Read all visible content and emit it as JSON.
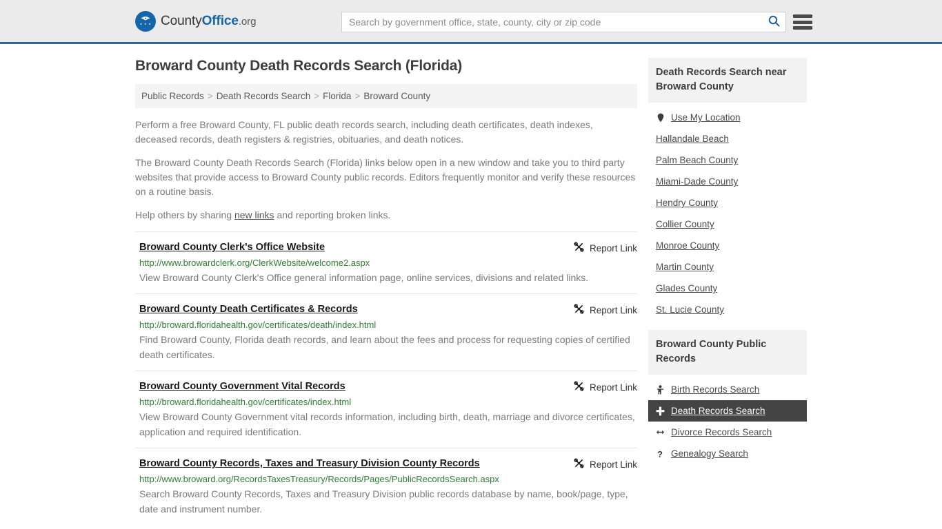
{
  "header": {
    "logo_name_1": "County",
    "logo_name_2": "Office",
    "logo_name_3": ".org",
    "search_placeholder": "Search by government office, state, county, city or zip code",
    "search_value": "",
    "search_icon": "search-icon",
    "menu_icon": "hamburger-menu-icon"
  },
  "main": {
    "title": "Broward County Death Records Search (Florida)",
    "breadcrumb": [
      "Public Records",
      "Death Records Search",
      "Florida",
      "Broward County"
    ],
    "breadcrumb_separator": ">",
    "intro": {
      "p1": "Perform a free Broward County, FL public death records search, including death certificates, death indexes, deceased records, death registers & registries, obituaries, and death notices.",
      "p2": "The Broward County Death Records Search (Florida) links below open in a new window and take you to third party websites that provide access to Broward County public records. Editors frequently monitor and verify these resources on a routine basis.",
      "p3_before": "Help others by sharing ",
      "p3_link": "new links",
      "p3_after": " and reporting broken links."
    },
    "report_label": "Report Link",
    "report_icon": "broken-link-icon",
    "results": [
      {
        "title": "Broward County Clerk's Office Website",
        "url": "http://www.browardclerk.org/ClerkWebsite/welcome2.aspx",
        "desc": "View Broward County Clerk's Office general information page, online services, divisions and related links."
      },
      {
        "title": "Broward County Death Certificates & Records",
        "url": "http://broward.floridahealth.gov/certificates/death/index.html",
        "desc": "Find Broward County, Florida death records, and learn about the fees and process for requesting copies of certified death certificates."
      },
      {
        "title": "Broward County Government Vital Records",
        "url": "http://broward.floridahealth.gov/certificates/index.html",
        "desc": "View Broward County Government vital records information, including birth, death, marriage and divorce certificates, application and required identification."
      },
      {
        "title": "Broward County Records, Taxes and Treasury Division County Records",
        "url": "http://www.broward.org/RecordsTaxesTreasury/Records/Pages/PublicRecordsSearch.aspx",
        "desc": "Search Broward County Records, Taxes and Treasury Division public records database by name, book/page, type, date and instrument number."
      }
    ]
  },
  "sidebar": {
    "nearby": {
      "heading": "Death Records Search near Broward County",
      "items": [
        {
          "label": "Use My Location",
          "icon": "map-pin-icon"
        },
        {
          "label": "Hallandale Beach",
          "icon": ""
        },
        {
          "label": "Palm Beach County",
          "icon": ""
        },
        {
          "label": "Miami-Dade County",
          "icon": ""
        },
        {
          "label": "Hendry County",
          "icon": ""
        },
        {
          "label": "Collier County",
          "icon": ""
        },
        {
          "label": "Monroe County",
          "icon": ""
        },
        {
          "label": "Martin County",
          "icon": ""
        },
        {
          "label": "Glades County",
          "icon": ""
        },
        {
          "label": "St. Lucie County",
          "icon": ""
        }
      ]
    },
    "public_records": {
      "heading": "Broward County Public Records",
      "items": [
        {
          "label": "Birth Records Search",
          "icon": "baby-icon",
          "active": false
        },
        {
          "label": "Death Records Search",
          "icon": "cross-icon",
          "active": true
        },
        {
          "label": "Divorce Records Search",
          "icon": "double-arrow-icon",
          "active": false
        },
        {
          "label": "Genealogy Search",
          "icon": "question-mark-icon",
          "active": false
        }
      ]
    }
  },
  "colors": {
    "header_bg": "#ebebeb",
    "header_border": "#36689c",
    "brand_blue": "#1565a8",
    "url_green": "#2f7d32",
    "active_row_bg": "#444444",
    "panel_head_bg": "#f2f2f2"
  }
}
